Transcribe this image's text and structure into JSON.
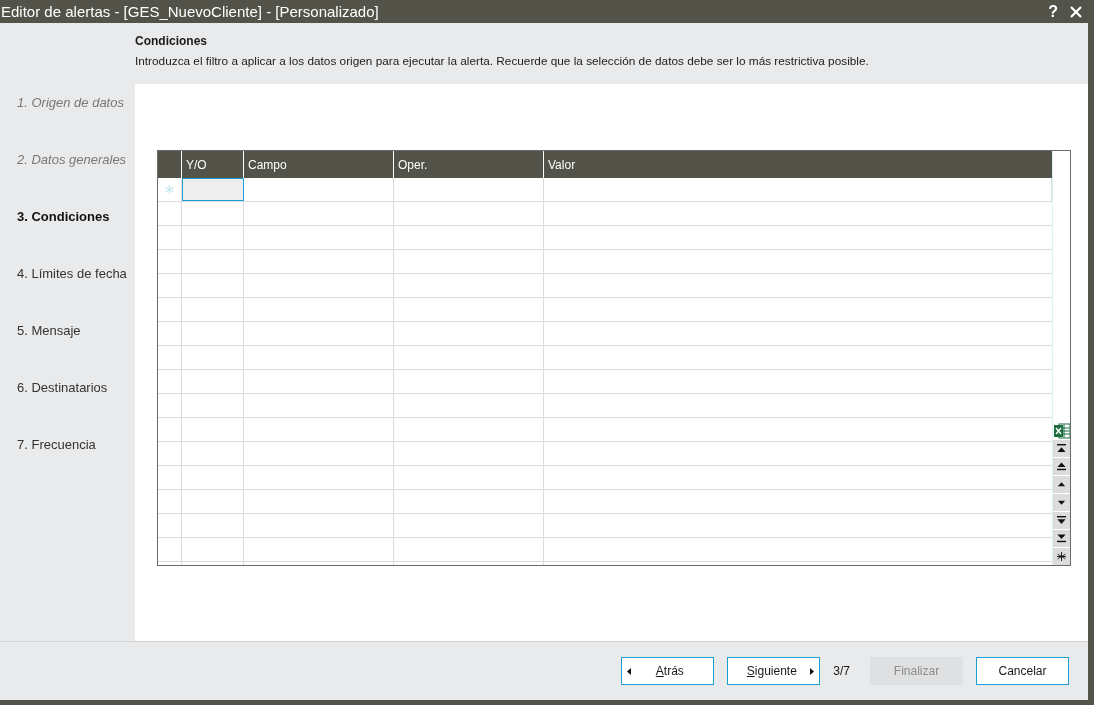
{
  "window": {
    "title": "Editor de alertas - [GES_NuevoCliente] - [Personalizado]",
    "help": "?"
  },
  "header": {
    "title": "Condiciones",
    "description": "Introduzca el filtro a aplicar a los datos origen para ejecutar la alerta. Recuerde que la selección de datos debe ser lo más restrictiva posible."
  },
  "steps": [
    {
      "label": "1. Origen de datos",
      "completed": true,
      "selected": false
    },
    {
      "label": "2. Datos generales",
      "completed": true,
      "selected": false
    },
    {
      "label": "3. Condiciones",
      "completed": false,
      "selected": true
    },
    {
      "label": "4. Límites de fecha",
      "completed": false,
      "selected": false
    },
    {
      "label": "5. Mensaje",
      "completed": false,
      "selected": false
    },
    {
      "label": "6. Destinatarios",
      "completed": false,
      "selected": false
    },
    {
      "label": "7. Frecuencia",
      "completed": false,
      "selected": false
    }
  ],
  "grid": {
    "columns": [
      {
        "label": "Y/O"
      },
      {
        "label": "Campo"
      },
      {
        "label": "Oper."
      },
      {
        "label": "Valor"
      }
    ],
    "new_row": {
      "cells": [
        {
          "selected": true
        },
        {
          "selected": false
        },
        {
          "selected": false
        },
        {
          "selected": false
        }
      ]
    }
  },
  "footer": [
    {
      "kind": "button",
      "label": "Atrás",
      "underline_first": true,
      "leading_arrow": true,
      "trailing_arrow": false,
      "disabled": false
    },
    {
      "kind": "button",
      "label": "Siguiente",
      "underline_first": true,
      "leading_arrow": false,
      "trailing_arrow": true,
      "disabled": false
    },
    {
      "kind": "counter",
      "text": "3/7"
    },
    {
      "kind": "button",
      "label": "Finalizar",
      "underline_first": false,
      "leading_arrow": false,
      "trailing_arrow": false,
      "disabled": true
    },
    {
      "kind": "button",
      "label": "Cancelar",
      "underline_first": false,
      "leading_arrow": false,
      "trailing_arrow": false,
      "disabled": false
    }
  ]
}
